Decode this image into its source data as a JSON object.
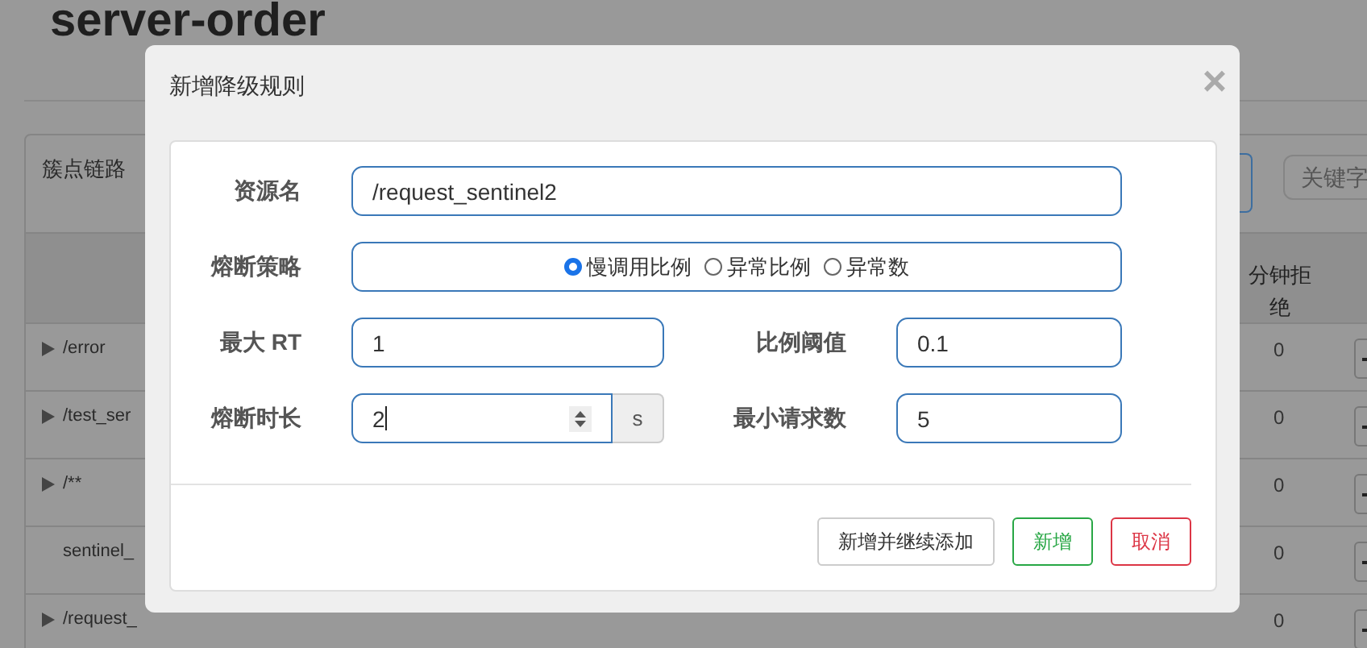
{
  "page": {
    "title": "server-order",
    "panel_title": "簇点链路",
    "search": {
      "placeholder": "关键字"
    },
    "column_header": "分钟拒绝",
    "rows": [
      {
        "resource": "/error",
        "expandable": true,
        "value": "0"
      },
      {
        "resource": "/test_ser",
        "expandable": true,
        "value": "0"
      },
      {
        "resource": "/**",
        "expandable": true,
        "value": "0"
      },
      {
        "resource": "sentinel_",
        "expandable": false,
        "value": "0"
      },
      {
        "resource": "/request_",
        "expandable": true,
        "value": "0"
      }
    ]
  },
  "dialog": {
    "title": "新增降级规则",
    "close": "×",
    "rows": [
      [
        {
          "kind": "text",
          "label": "资源名",
          "value": "/request_sentinel2"
        }
      ],
      [
        {
          "kind": "radio",
          "label": "熔断策略",
          "options": [
            {
              "label": "慢调用比例",
              "selected": true
            },
            {
              "label": "异常比例",
              "selected": false
            },
            {
              "label": "异常数",
              "selected": false
            }
          ]
        }
      ],
      [
        {
          "kind": "text",
          "label": "最大 RT",
          "value": "1"
        },
        {
          "kind": "text",
          "label": "比例阈值",
          "value": "0.1"
        }
      ],
      [
        {
          "kind": "number",
          "label": "熔断时长",
          "value": "2",
          "unit": "s"
        },
        {
          "kind": "text",
          "label": "最小请求数",
          "value": "5"
        }
      ]
    ],
    "buttons": [
      {
        "label": "新增并继续添加",
        "kind": "default"
      },
      {
        "label": "新增",
        "kind": "success"
      },
      {
        "label": "取消",
        "kind": "danger"
      }
    ]
  }
}
